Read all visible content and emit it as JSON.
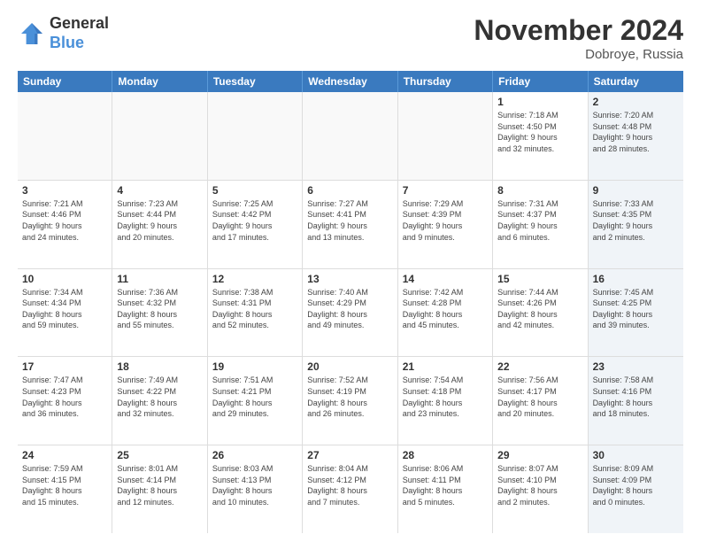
{
  "logo": {
    "line1": "General",
    "line2": "Blue"
  },
  "title": "November 2024",
  "location": "Dobroye, Russia",
  "days_of_week": [
    "Sunday",
    "Monday",
    "Tuesday",
    "Wednesday",
    "Thursday",
    "Friday",
    "Saturday"
  ],
  "weeks": [
    [
      {
        "day": "",
        "info": "",
        "shaded": false,
        "empty": true
      },
      {
        "day": "",
        "info": "",
        "shaded": false,
        "empty": true
      },
      {
        "day": "",
        "info": "",
        "shaded": false,
        "empty": true
      },
      {
        "day": "",
        "info": "",
        "shaded": false,
        "empty": true
      },
      {
        "day": "",
        "info": "",
        "shaded": false,
        "empty": true
      },
      {
        "day": "1",
        "info": "Sunrise: 7:18 AM\nSunset: 4:50 PM\nDaylight: 9 hours\nand 32 minutes.",
        "shaded": false,
        "empty": false
      },
      {
        "day": "2",
        "info": "Sunrise: 7:20 AM\nSunset: 4:48 PM\nDaylight: 9 hours\nand 28 minutes.",
        "shaded": true,
        "empty": false
      }
    ],
    [
      {
        "day": "3",
        "info": "Sunrise: 7:21 AM\nSunset: 4:46 PM\nDaylight: 9 hours\nand 24 minutes.",
        "shaded": false,
        "empty": false
      },
      {
        "day": "4",
        "info": "Sunrise: 7:23 AM\nSunset: 4:44 PM\nDaylight: 9 hours\nand 20 minutes.",
        "shaded": false,
        "empty": false
      },
      {
        "day": "5",
        "info": "Sunrise: 7:25 AM\nSunset: 4:42 PM\nDaylight: 9 hours\nand 17 minutes.",
        "shaded": false,
        "empty": false
      },
      {
        "day": "6",
        "info": "Sunrise: 7:27 AM\nSunset: 4:41 PM\nDaylight: 9 hours\nand 13 minutes.",
        "shaded": false,
        "empty": false
      },
      {
        "day": "7",
        "info": "Sunrise: 7:29 AM\nSunset: 4:39 PM\nDaylight: 9 hours\nand 9 minutes.",
        "shaded": false,
        "empty": false
      },
      {
        "day": "8",
        "info": "Sunrise: 7:31 AM\nSunset: 4:37 PM\nDaylight: 9 hours\nand 6 minutes.",
        "shaded": false,
        "empty": false
      },
      {
        "day": "9",
        "info": "Sunrise: 7:33 AM\nSunset: 4:35 PM\nDaylight: 9 hours\nand 2 minutes.",
        "shaded": true,
        "empty": false
      }
    ],
    [
      {
        "day": "10",
        "info": "Sunrise: 7:34 AM\nSunset: 4:34 PM\nDaylight: 8 hours\nand 59 minutes.",
        "shaded": false,
        "empty": false
      },
      {
        "day": "11",
        "info": "Sunrise: 7:36 AM\nSunset: 4:32 PM\nDaylight: 8 hours\nand 55 minutes.",
        "shaded": false,
        "empty": false
      },
      {
        "day": "12",
        "info": "Sunrise: 7:38 AM\nSunset: 4:31 PM\nDaylight: 8 hours\nand 52 minutes.",
        "shaded": false,
        "empty": false
      },
      {
        "day": "13",
        "info": "Sunrise: 7:40 AM\nSunset: 4:29 PM\nDaylight: 8 hours\nand 49 minutes.",
        "shaded": false,
        "empty": false
      },
      {
        "day": "14",
        "info": "Sunrise: 7:42 AM\nSunset: 4:28 PM\nDaylight: 8 hours\nand 45 minutes.",
        "shaded": false,
        "empty": false
      },
      {
        "day": "15",
        "info": "Sunrise: 7:44 AM\nSunset: 4:26 PM\nDaylight: 8 hours\nand 42 minutes.",
        "shaded": false,
        "empty": false
      },
      {
        "day": "16",
        "info": "Sunrise: 7:45 AM\nSunset: 4:25 PM\nDaylight: 8 hours\nand 39 minutes.",
        "shaded": true,
        "empty": false
      }
    ],
    [
      {
        "day": "17",
        "info": "Sunrise: 7:47 AM\nSunset: 4:23 PM\nDaylight: 8 hours\nand 36 minutes.",
        "shaded": false,
        "empty": false
      },
      {
        "day": "18",
        "info": "Sunrise: 7:49 AM\nSunset: 4:22 PM\nDaylight: 8 hours\nand 32 minutes.",
        "shaded": false,
        "empty": false
      },
      {
        "day": "19",
        "info": "Sunrise: 7:51 AM\nSunset: 4:21 PM\nDaylight: 8 hours\nand 29 minutes.",
        "shaded": false,
        "empty": false
      },
      {
        "day": "20",
        "info": "Sunrise: 7:52 AM\nSunset: 4:19 PM\nDaylight: 8 hours\nand 26 minutes.",
        "shaded": false,
        "empty": false
      },
      {
        "day": "21",
        "info": "Sunrise: 7:54 AM\nSunset: 4:18 PM\nDaylight: 8 hours\nand 23 minutes.",
        "shaded": false,
        "empty": false
      },
      {
        "day": "22",
        "info": "Sunrise: 7:56 AM\nSunset: 4:17 PM\nDaylight: 8 hours\nand 20 minutes.",
        "shaded": false,
        "empty": false
      },
      {
        "day": "23",
        "info": "Sunrise: 7:58 AM\nSunset: 4:16 PM\nDaylight: 8 hours\nand 18 minutes.",
        "shaded": true,
        "empty": false
      }
    ],
    [
      {
        "day": "24",
        "info": "Sunrise: 7:59 AM\nSunset: 4:15 PM\nDaylight: 8 hours\nand 15 minutes.",
        "shaded": false,
        "empty": false
      },
      {
        "day": "25",
        "info": "Sunrise: 8:01 AM\nSunset: 4:14 PM\nDaylight: 8 hours\nand 12 minutes.",
        "shaded": false,
        "empty": false
      },
      {
        "day": "26",
        "info": "Sunrise: 8:03 AM\nSunset: 4:13 PM\nDaylight: 8 hours\nand 10 minutes.",
        "shaded": false,
        "empty": false
      },
      {
        "day": "27",
        "info": "Sunrise: 8:04 AM\nSunset: 4:12 PM\nDaylight: 8 hours\nand 7 minutes.",
        "shaded": false,
        "empty": false
      },
      {
        "day": "28",
        "info": "Sunrise: 8:06 AM\nSunset: 4:11 PM\nDaylight: 8 hours\nand 5 minutes.",
        "shaded": false,
        "empty": false
      },
      {
        "day": "29",
        "info": "Sunrise: 8:07 AM\nSunset: 4:10 PM\nDaylight: 8 hours\nand 2 minutes.",
        "shaded": false,
        "empty": false
      },
      {
        "day": "30",
        "info": "Sunrise: 8:09 AM\nSunset: 4:09 PM\nDaylight: 8 hours\nand 0 minutes.",
        "shaded": true,
        "empty": false
      }
    ]
  ]
}
